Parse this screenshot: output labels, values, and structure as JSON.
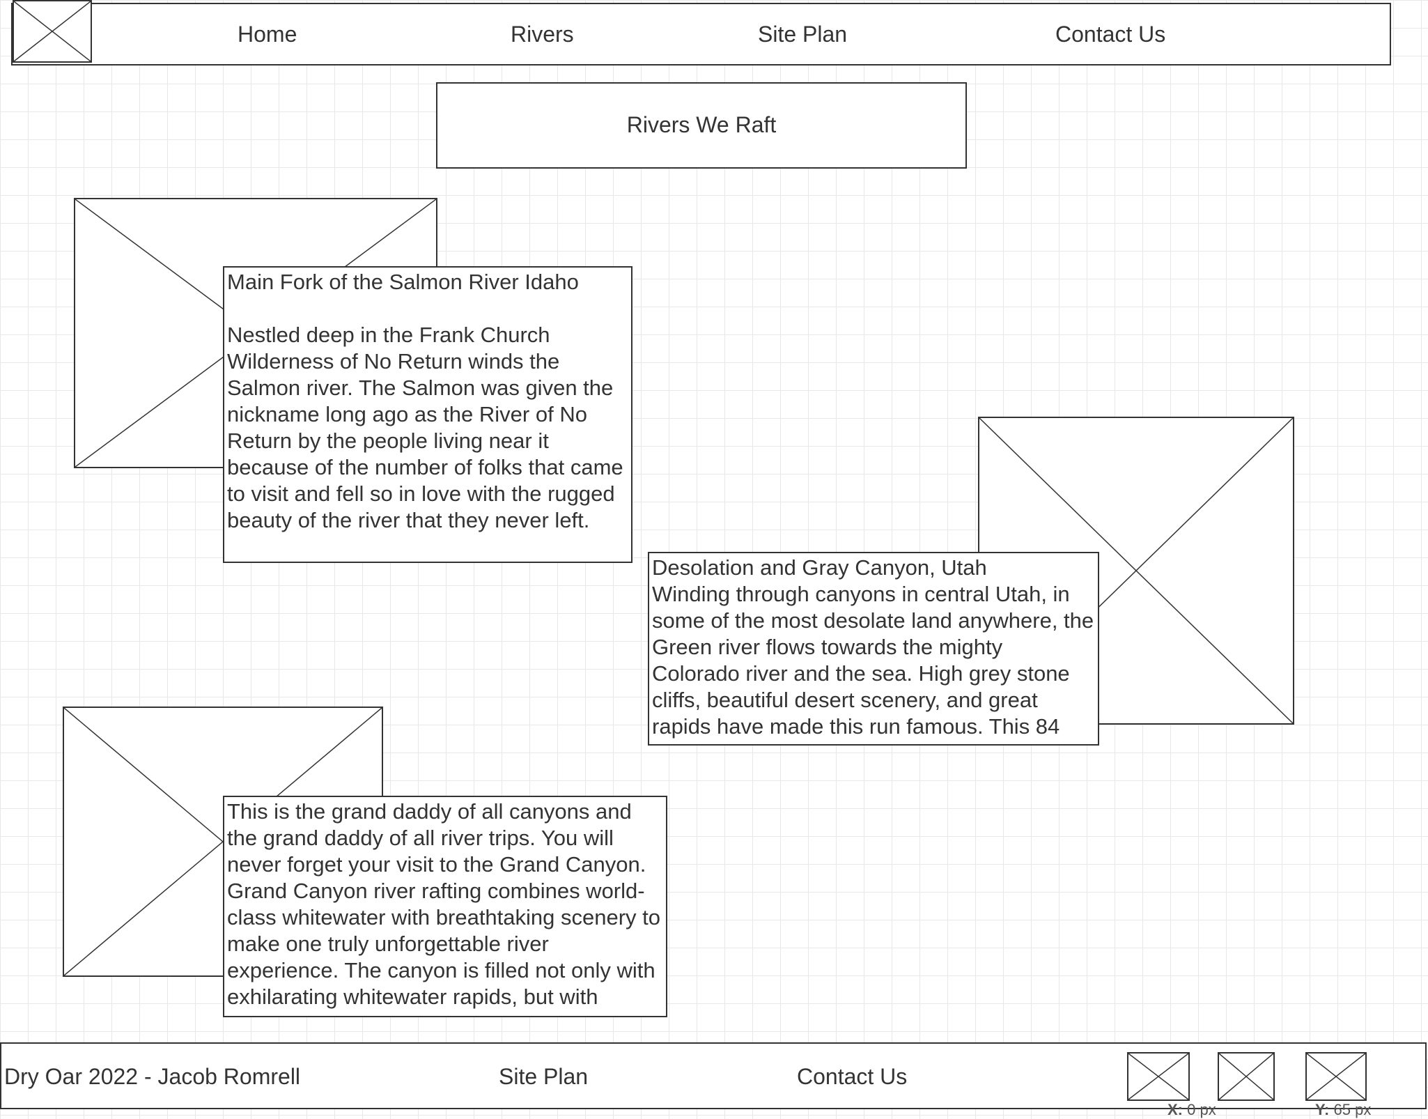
{
  "header": {
    "logo_icon": "logo-placeholder-icon",
    "nav": [
      "Home",
      "Rivers",
      "Site Plan",
      "Contact Us"
    ]
  },
  "page_title": "Rivers We Raft",
  "rivers": [
    {
      "title": "Main Fork of the Salmon River Idaho",
      "description": "Nestled deep in the Frank Church Wilderness of No Return winds the Salmon river. The Salmon was given the nickname long ago as the River of No Return by the people living near it because of the number of folks that came to visit and fell so in love with the rugged beauty of the river that they never left.",
      "image_icon": "image-placeholder-icon"
    },
    {
      "title": "Desolation and Gray Canyon, Utah",
      "description": "Winding through canyons in central Utah, in some of the most desolate land anywhere, the Green river flows towards the mighty Colorado river and the sea. High grey stone cliffs, beautiful desert scenery, and great rapids have made this run famous. This 84",
      "image_icon": "image-placeholder-icon"
    },
    {
      "description": "This is the grand daddy of all canyons and the grand daddy of all river trips. You will never forget your visit to the Grand Canyon. Grand Canyon river rafting combines world-class whitewater with breathtaking scenery to make one truly unforgettable river experience. The canyon is filled not only with exhilarating whitewater rapids, but with",
      "image_icon": "image-placeholder-icon"
    }
  ],
  "footer": {
    "credit": "Dry Oar 2022 - Jacob Romrell",
    "links": [
      "Site Plan",
      "Contact Us"
    ],
    "social_icons": [
      "social-placeholder-icon",
      "social-placeholder-icon",
      "social-placeholder-icon"
    ]
  },
  "coordinate_readout": {
    "x_label": "X:",
    "x_value": "0 px",
    "y_label": "Y:",
    "y_value": "65 px"
  }
}
